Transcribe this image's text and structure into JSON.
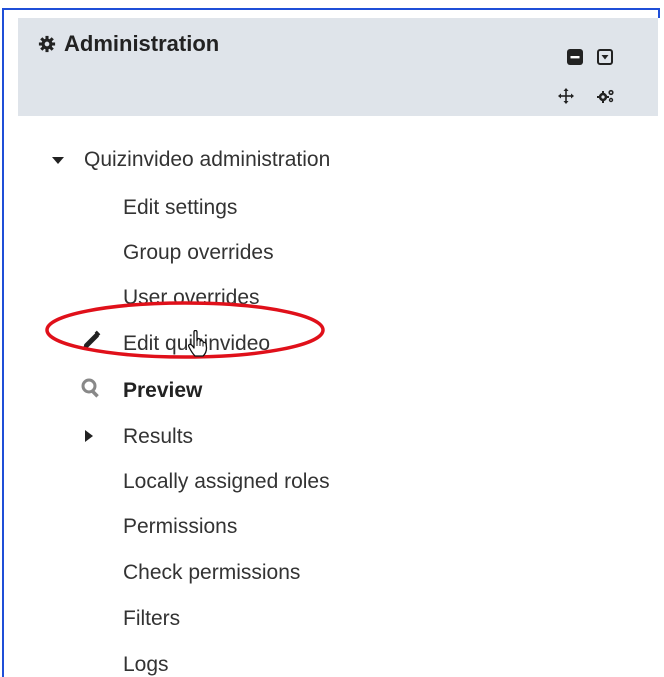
{
  "block": {
    "title": "Administration",
    "icons": {
      "title_icon": "gear-icon",
      "collapse": "minus-square-icon",
      "dock": "dropdown-square-icon",
      "move": "move-icon",
      "actions": "gears-icon"
    }
  },
  "menu": {
    "section_label": "Quizinvideo administration",
    "items": [
      {
        "label": "Edit settings"
      },
      {
        "label": "Group overrides"
      },
      {
        "label": "User overrides"
      },
      {
        "label": "Edit quizinvideo",
        "icon": "pencil-icon"
      },
      {
        "label": "Preview",
        "icon": "search-icon"
      },
      {
        "label": "Results",
        "icon": "caret-right-icon"
      },
      {
        "label": "Locally assigned roles"
      },
      {
        "label": "Permissions"
      },
      {
        "label": "Check permissions"
      },
      {
        "label": "Filters"
      },
      {
        "label": "Logs"
      }
    ]
  },
  "colors": {
    "header_bg": "#dfe4ea",
    "frame_border": "#1f4fd8",
    "highlight_ellipse": "#e0101a"
  }
}
